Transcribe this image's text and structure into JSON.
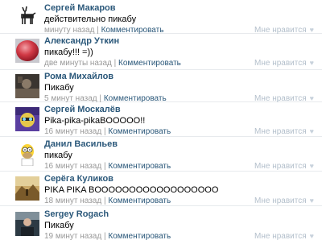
{
  "comments": [
    {
      "author": "Сергей Макаров",
      "text": "действительно пикабу",
      "time": "минуту назад",
      "separator": "|",
      "reply": "Комментировать",
      "like": "Мне нравится",
      "heart_icon": "♥",
      "avatar_icon": "deer-drawing-avatar"
    },
    {
      "author": "Александр Уткин",
      "text": "пикабу!!! =))",
      "time": "две минуты назад",
      "separator": "|",
      "reply": "Комментировать",
      "like": "Мне нравится",
      "heart_icon": "♥",
      "avatar_icon": "red-balloon-avatar"
    },
    {
      "author": "Рома Михайлов",
      "text": "Пикабу",
      "time": "5 минут назад",
      "separator": "|",
      "reply": "Комментировать",
      "like": "Мне нравится",
      "heart_icon": "♥",
      "avatar_icon": "dark-photo-avatar"
    },
    {
      "author": "Сергей Москалёв",
      "text": "Pika-pika-pikaBOOOOO!!",
      "time": "16 минут назад",
      "separator": "|",
      "reply": "Комментировать",
      "like": "Мне нравится",
      "heart_icon": "♥",
      "avatar_icon": "purple-cartoon-avatar"
    },
    {
      "author": "Данил Васильев",
      "text": "пикабу",
      "time": "16 минут назад",
      "separator": "|",
      "reply": "Комментировать",
      "like": "Мне нравится",
      "heart_icon": "♥",
      "avatar_icon": "homer-simpson-avatar"
    },
    {
      "author": "Серёга Куликов",
      "text": "PIKA PIKA BOOOOOOOOOOOOOOOOOO",
      "time": "18 минут назад",
      "separator": "|",
      "reply": "Комментировать",
      "like": "Мне нравится",
      "heart_icon": "♥",
      "avatar_icon": "landscape-photo-avatar"
    },
    {
      "author": "Sergey Rogach",
      "text": "Пикабу",
      "time": "19 минут назад",
      "separator": "|",
      "reply": "Комментировать",
      "like": "Мне нравится",
      "heart_icon": "♥",
      "avatar_icon": "person-photo-avatar"
    }
  ],
  "colors": {
    "link": "#2b587a",
    "meta": "#999999",
    "like": "#b4c0cc",
    "divider": "#e7eaed"
  }
}
